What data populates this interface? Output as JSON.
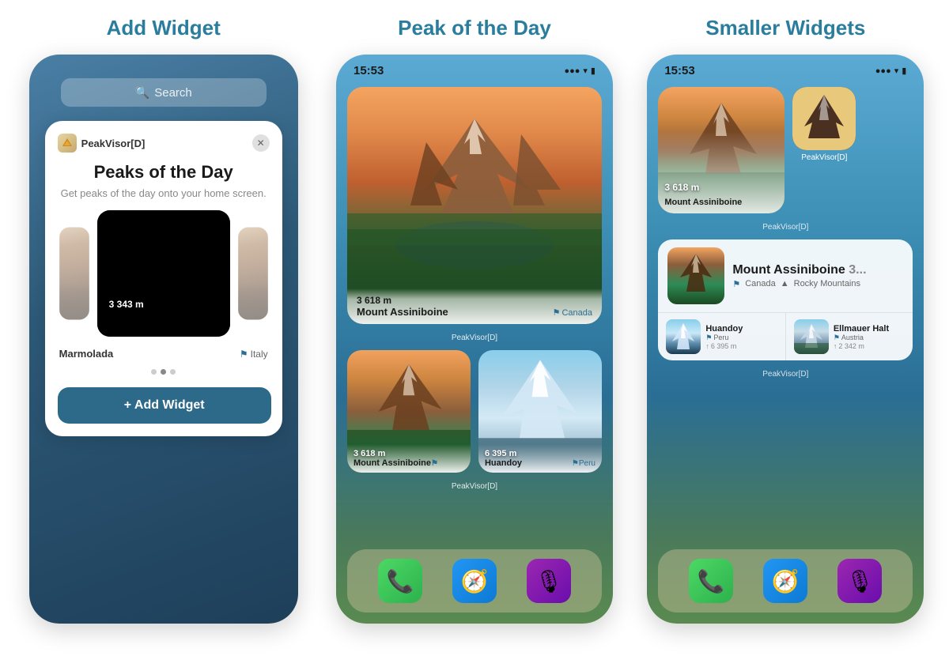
{
  "columns": [
    {
      "title": "Add Widget",
      "type": "add_widget"
    },
    {
      "title": "Peak of the Day",
      "type": "peak_day"
    },
    {
      "title": "Smaller Widgets",
      "type": "smaller_widgets"
    }
  ],
  "add_widget": {
    "search_placeholder": "Search",
    "app_name": "PeakVisor[D]",
    "card_title": "Peaks of the Day",
    "card_subtitle": "Get peaks of the day onto your home screen.",
    "peak_name": "Marmolada",
    "altitude": "3 343 m",
    "country": "Italy",
    "add_button": "+ Add Widget",
    "dots": [
      "",
      "",
      ""
    ]
  },
  "peak_day": {
    "status_time": "15:53",
    "app_label_1": "PeakVisor[D]",
    "app_label_2": "PeakVisor[D]",
    "large_widget": {
      "peak_name": "Mount Assiniboine",
      "altitude": "3 618 m",
      "country": "Canada"
    },
    "small_widgets": [
      {
        "peak_name": "Mount Assiniboine",
        "altitude": "3 618 m",
        "country": ""
      },
      {
        "peak_name": "Huandoy",
        "altitude": "6 395 m",
        "country": "Peru"
      }
    ]
  },
  "smaller_widgets": {
    "status_time": "15:53",
    "app_label_1": "PeakVisor[D]",
    "app_label_2": "PeakVisor[D]",
    "small_widget_top": {
      "peak_name": "Mount Assiniboine",
      "altitude": "3 618 m"
    },
    "app_icon_label": "PeakVisor[D]",
    "medium_widget": {
      "peak_name": "Mount Assiniboine",
      "altitude": "3...",
      "region1": "Canada",
      "region2": "Rocky Mountains"
    },
    "mini_widgets": [
      {
        "peak_name": "Huandoy",
        "country": "Peru",
        "altitude": "6 395 m"
      },
      {
        "peak_name": "Ellmauer Halt",
        "country": "Austria",
        "altitude": "2 342 m"
      }
    ]
  },
  "icons": {
    "search": "🔍",
    "close": "✕",
    "add": "+",
    "flag": "⚑",
    "mountain": "▲",
    "phone": "📞",
    "wifi": "📶",
    "battery": "🔋",
    "signal": "●●●"
  }
}
